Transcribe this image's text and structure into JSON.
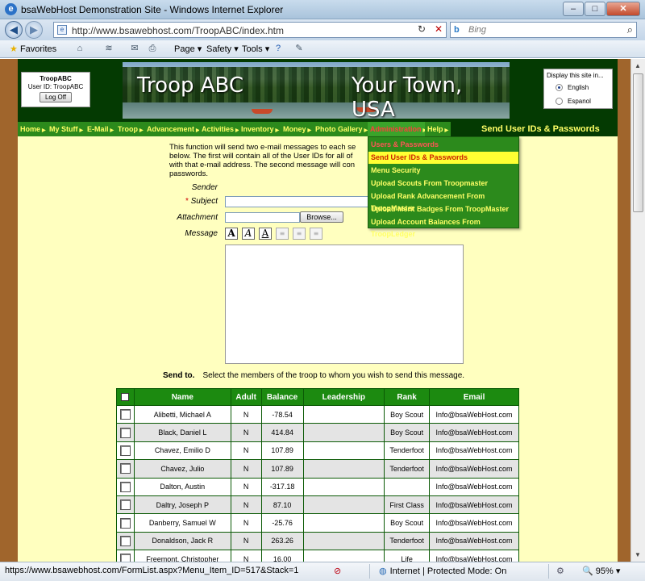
{
  "browser": {
    "window_title": "bsaWebHost Demonstration Site - Windows Internet Explorer",
    "address": "http://www.bsawebhost.com/TroopABC/index.htm",
    "search_placeholder": "Bing",
    "favorites_label": "Favorites",
    "menu": {
      "page": "Page",
      "safety": "Safety",
      "tools": "Tools"
    },
    "status_url": "https://www.bsawebhost.com/FormList.aspx?Menu_Item_ID=517&Stack=1",
    "zone": "Internet | Protected Mode: On",
    "zoom": "95%"
  },
  "site": {
    "login": {
      "troop": "TroopABC",
      "user_id": "User ID:  TroopABC",
      "logoff": "Log Off"
    },
    "banner": {
      "title_left": "Troop ABC",
      "title_right": "Your Town, USA"
    },
    "language": {
      "label": "Display this site in...",
      "options": [
        "English",
        "Espanol"
      ],
      "selected": "English"
    },
    "nav": [
      {
        "label": "Home"
      },
      {
        "label": "My Stuff"
      },
      {
        "label": "E-Mail"
      },
      {
        "label": "Troop"
      },
      {
        "label": "Advancement"
      },
      {
        "label": "Activities"
      },
      {
        "label": "Inventory"
      },
      {
        "label": "Money"
      },
      {
        "label": "Photo Gallery"
      },
      {
        "label": "Administration"
      },
      {
        "label": "Help"
      }
    ],
    "page_title": "Send User IDs & Passwords",
    "admin_menu": [
      "Users & Passwords",
      "Send User IDs & Passwords",
      "Menu Security",
      "Upload Scouts From Troopmaster",
      "Upload Rank Advancement From TroopMaster",
      "Upload Merit Badges From TroopMaster",
      "Upload Account Balances From TroopLedger"
    ]
  },
  "form": {
    "intro": "This function will send two e-mail messages to each se below. The first will contain all of the User IDs for all of with that e-mail address. The second message will con passwords.",
    "sender_label": "Sender",
    "subject_label": "Subject",
    "attachment_label": "Attachment",
    "message_label": "Message",
    "browse_label": "Browse...",
    "send_to_label": "Send to.",
    "send_to_text": "Select the members of the troop to whom you wish to send this message."
  },
  "table": {
    "columns": [
      "Name",
      "Adult",
      "Balance",
      "Leadership",
      "Rank",
      "Email"
    ],
    "rows": [
      {
        "name": "Alibetti, Michael A",
        "adult": "N",
        "balance": "-78.54",
        "leadership": "",
        "rank": "Boy Scout",
        "email": "Info@bsaWebHost.com"
      },
      {
        "name": "Black, Daniel L",
        "adult": "N",
        "balance": "414.84",
        "leadership": "",
        "rank": "Boy Scout",
        "email": "Info@bsaWebHost.com"
      },
      {
        "name": "Chavez, Emilio D",
        "adult": "N",
        "balance": "107.89",
        "leadership": "",
        "rank": "Tenderfoot",
        "email": "Info@bsaWebHost.com"
      },
      {
        "name": "Chavez, Julio",
        "adult": "N",
        "balance": "107.89",
        "leadership": "",
        "rank": "Tenderfoot",
        "email": "Info@bsaWebHost.com"
      },
      {
        "name": "Dalton, Austin",
        "adult": "N",
        "balance": "-317.18",
        "leadership": "",
        "rank": "",
        "email": "Info@bsaWebHost.com"
      },
      {
        "name": "Daltry, Joseph P",
        "adult": "N",
        "balance": "87.10",
        "leadership": "",
        "rank": "First Class",
        "email": "Info@bsaWebHost.com"
      },
      {
        "name": "Danberry, Samuel W",
        "adult": "N",
        "balance": "-25.76",
        "leadership": "",
        "rank": "Boy Scout",
        "email": "Info@bsaWebHost.com"
      },
      {
        "name": "Donaldson, Jack R",
        "adult": "N",
        "balance": "263.26",
        "leadership": "",
        "rank": "Tenderfoot",
        "email": "Info@bsaWebHost.com"
      },
      {
        "name": "Freemont, Christopher",
        "adult": "N",
        "balance": "16.00",
        "leadership": "",
        "rank": "Life",
        "email": "Info@bsaWebHost.com"
      }
    ]
  }
}
